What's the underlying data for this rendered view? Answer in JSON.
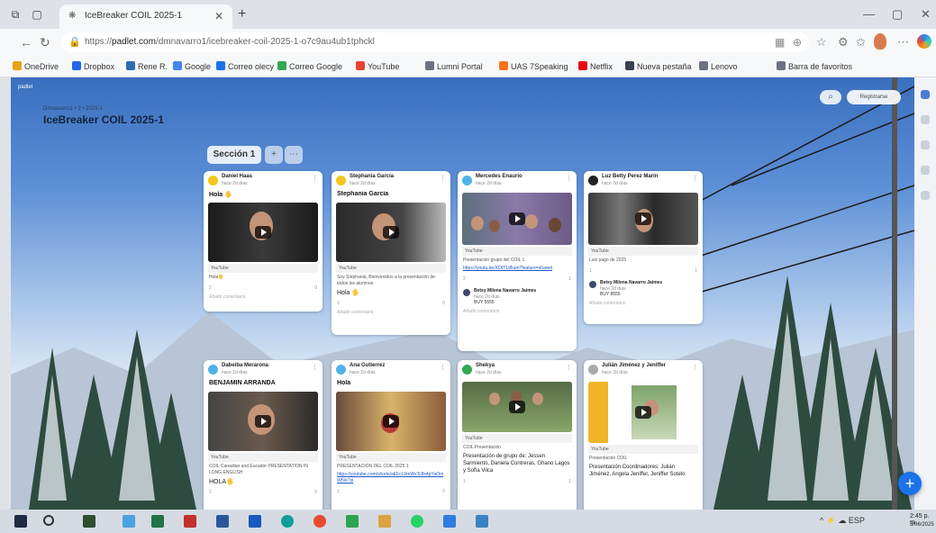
{
  "browser": {
    "tab_title": "IceBreaker COIL 2025-1",
    "url_prefix": "https://",
    "url_domain": "padlet.com",
    "url_path": "/dmnavarro1/icebreaker-coil-2025-1-o7c9au4ub1tphckl",
    "bookmarks": [
      "OneDrive",
      "Dropbox",
      "Rene R.",
      "Google",
      "Correo olecy",
      "Correo Google",
      "YouTube",
      "Lumni Portal",
      "UAS 7Speaking",
      "Netflix",
      "Nueva pestaña",
      "Lenovo",
      "Barra de favoritos"
    ],
    "bookmark_colors": [
      "#e8a317",
      "#2563eb",
      "#2b6cb0",
      "#4285f4",
      "#1a73e8",
      "#34a853",
      "#ea4335",
      "#6b7280",
      "#f97316",
      "#e50914",
      "#374151",
      "#6b7280",
      "#6b7280"
    ]
  },
  "board": {
    "brand": "padlet",
    "breadcrumb": "Dmnavarro1 • 2 • 2025-1",
    "title": "IceBreaker COIL 2025-1",
    "search_icon": "search-icon",
    "register_label": "Registrarse",
    "section_label": "Sección 1",
    "fab_label": "+"
  },
  "cards": [
    {
      "author": "Daniel Haas",
      "time": "hace 2d días",
      "title": "Hola 🖐",
      "source": "YouTube",
      "desc": "Hola🖐",
      "likes": "2",
      "comments": "0",
      "add_comment": "Añadir comentario",
      "avatar": "#f5c518"
    },
    {
      "author": "Stephania García",
      "time": "hace 2d días",
      "title": "Stephania García",
      "source": "YouTube",
      "desc": "Soy Stephania, Bienvenidos a la presentación de todos los alumnos",
      "body": "Hola 🖐",
      "likes": "1",
      "comments": "0",
      "add_comment": "Añadir comentario",
      "avatar": "#f5c518"
    },
    {
      "author": "Mercedes Enaurio",
      "time": "hace 2d días",
      "source": "YouTube",
      "desc": "Presentación grupo del COIL 1",
      "link": "https://youtu.be/XOtT1d5um?feature=shared",
      "likes": "2",
      "comments": "1",
      "reply_name": "Betsy Milena Navarro Jaimes",
      "reply_time": "hace 2d días",
      "reply_text": "BUY 5555",
      "add_comment": "Añadir comentario",
      "avatar": "#4fb3e8"
    },
    {
      "author": "Luz Betty Perez Marín",
      "time": "hace 2d días",
      "source": "YouTube",
      "desc": "Luis pago de 2025",
      "likes": "1",
      "comments": "1",
      "reply_name": "Betsy Milena Navarro Jaimes",
      "reply_time": "hace 2d días",
      "reply_text": "BUY 8555",
      "add_comment": "Añadir comentario",
      "avatar": "#222222"
    },
    {
      "author": "Dabeiba Merarona",
      "time": "hace 2d días",
      "title": "BENJAMIN ARRANDA",
      "source": "YouTube",
      "desc": "COIL Canadian and Eucador PRESENTATION IN LONG ENGLISH",
      "body": "HOLA🖐",
      "likes": "2",
      "comments": "0",
      "add_comment": "",
      "avatar": "#4fb3e8"
    },
    {
      "author": "Ana Gutierrez",
      "time": "hace 2d días",
      "title": "Hola",
      "source": "YouTube",
      "desc": "PRESENTACION DEL COIL 2025 1",
      "link": "https://youtube.com/shorts/aEFcL0mWxTc8s4pYaOmWfVe?si",
      "likes": "1",
      "comments": "0",
      "add_comment": "",
      "avatar": "#4fb3e8"
    },
    {
      "author": "Shekya",
      "time": "hace 2d días",
      "source": "YouTube",
      "desc": "COIL Presentación",
      "body": "Presentación de grupo de: Jessen Sarmiento, Daniela Contreras, Ghano Lagos y Sofía Vilca",
      "likes": "1",
      "comments": "1",
      "add_comment": "",
      "avatar": "#34a853"
    },
    {
      "author": "Julián Jiménez y Jeniffer",
      "time": "hace 2d días",
      "source": "YouTube",
      "desc": "Presentación COIL",
      "body": "Presentación Coordinadores: Julián Jiménez, Angela Jeniffer, Jeniffer Sotelo",
      "likes": "",
      "comments": "",
      "add_comment": "",
      "avatar": "#aaaaaa"
    }
  ],
  "taskbar": {
    "time": "2:45 p. m.",
    "date": "3/06/2025",
    "tray": "^ ⚡ ☁ ESP"
  }
}
